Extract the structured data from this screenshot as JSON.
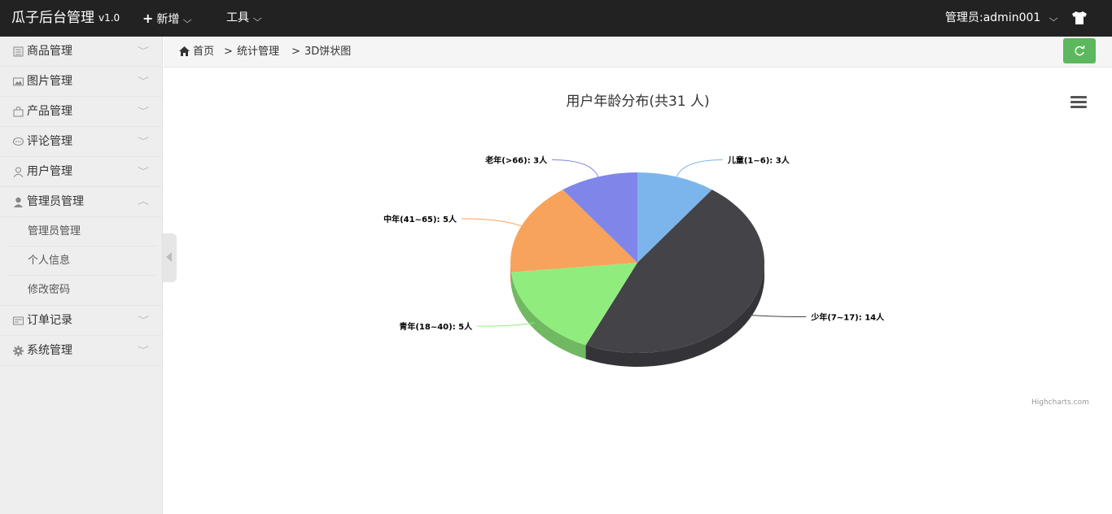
{
  "topbar": {
    "brand": "瓜子后台管理",
    "version": "v1.0",
    "add_menu": "新增",
    "tools_menu": "工具",
    "user": "管理员:admin001"
  },
  "sidebar": {
    "items": [
      {
        "label": "商品管理",
        "icon": "list-icon"
      },
      {
        "label": "图片管理",
        "icon": "image-icon"
      },
      {
        "label": "产品管理",
        "icon": "bag-icon"
      },
      {
        "label": "评论管理",
        "icon": "comment-icon"
      },
      {
        "label": "用户管理",
        "icon": "user-icon"
      },
      {
        "label": "管理员管理",
        "icon": "admin-icon"
      }
    ],
    "sub_items": [
      "管理员管理",
      "个人信息",
      "修改密码"
    ],
    "items_after": [
      {
        "label": "订单记录",
        "icon": "order-icon"
      },
      {
        "label": "系统管理",
        "icon": "gear-icon"
      }
    ]
  },
  "breadcrumb": {
    "home": "首页",
    "sep": ">",
    "level1": "统计管理",
    "level2": "3D饼状图"
  },
  "chart_data": {
    "type": "pie",
    "title": "用户年龄分布(共31 人)",
    "categories": [
      "儿童(1~6)",
      "少年(7~17)",
      "青年(18~40)",
      "中年(41~65)",
      "老年(>66)"
    ],
    "values": [
      3,
      14,
      5,
      5,
      3
    ],
    "unit": "人",
    "colors": [
      "#7cb5ec",
      "#434348",
      "#90ed7d",
      "#f7a35c",
      "#8085e9"
    ],
    "labels": [
      "儿童(1~6): 3人",
      "少年(7~17): 14人",
      "青年(18~40): 5人",
      "中年(41~65): 5人",
      "老年(>66): 3人"
    ],
    "3d": true,
    "credits": "Highcharts.com"
  }
}
